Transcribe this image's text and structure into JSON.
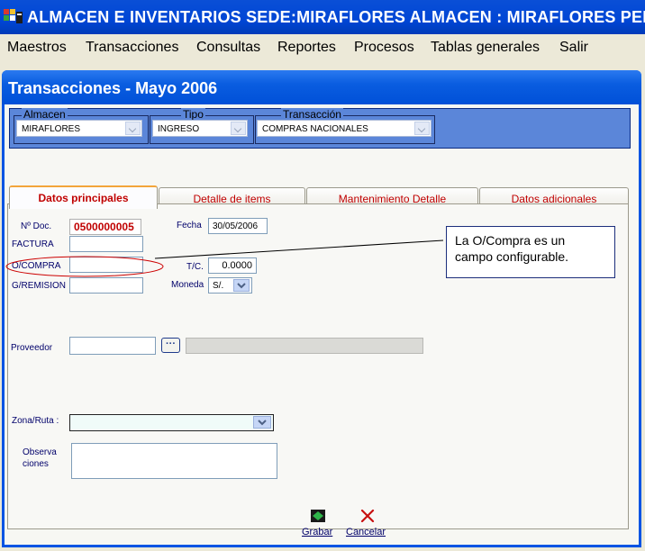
{
  "app": {
    "title": "ALMACEN E INVENTARIOS  SEDE:MIRAFLORES  ALMACEN : MIRAFLORES  PER"
  },
  "menu": [
    "Maestros",
    "Transacciones",
    "Consultas",
    "Reportes",
    "Procesos",
    "Tablas generales",
    "Salir"
  ],
  "window": {
    "title": "Transacciones - Mayo 2006"
  },
  "filter": {
    "almacen_label": "Almacen",
    "almacen_value": "MIRAFLORES",
    "tipo_label": "Tipo",
    "tipo_value": "INGRESO",
    "transaccion_label": "Transacción",
    "transaccion_value": "COMPRAS NACIONALES"
  },
  "tabs": [
    "Datos principales",
    "Detalle de items",
    "Mantenimiento Detalle",
    "Datos adicionales"
  ],
  "form": {
    "ndoc_label": "Nº Doc.",
    "ndoc_value": "0500000005",
    "fecha_label": "Fecha",
    "fecha_value": "30/05/2006",
    "factura_label": "FACTURA",
    "factura_value": "",
    "ocompra_label": "O/COMPRA",
    "ocompra_value": "",
    "tc_label": "T/C.",
    "tc_value": "0.0000",
    "gremision_label": "G/REMISION",
    "gremision_value": "",
    "moneda_label": "Moneda",
    "moneda_value": "S/.",
    "proveedor_label": "Proveedor",
    "proveedor_value": "",
    "proveedor_lookup": "···",
    "proveedor_name": "",
    "zona_label": "Zona/Ruta :",
    "zona_value": "",
    "observ_label_1": "Observa",
    "observ_label_2": "ciones",
    "observ_value": ""
  },
  "callout": {
    "text_1": "La O/Compra es un",
    "text_2": "campo configurable."
  },
  "toolbar": {
    "save_label": "Grabar",
    "cancel_label": "Cancelar"
  },
  "colors": {
    "title_bar": "#0046d5",
    "filter_band": "#5b86d9",
    "tab_text": "#c00000",
    "label_text": "#00006a",
    "annotation_ellipse": "#cc0000"
  },
  "icons": {
    "app": "app-logo-icon",
    "save": "save-disk-icon",
    "cancel": "close-x-icon"
  }
}
